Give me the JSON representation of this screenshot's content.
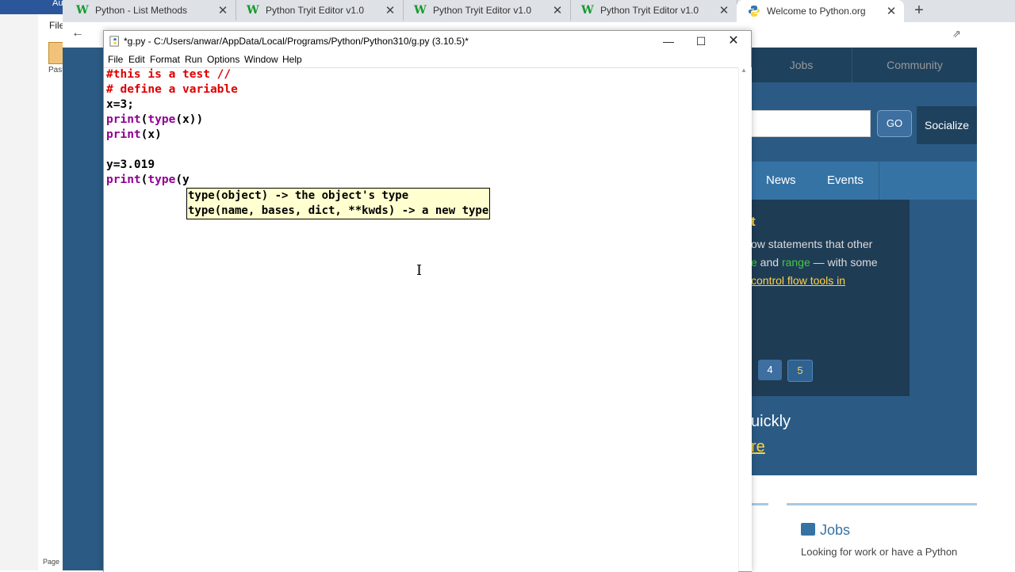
{
  "word": {
    "title_fragment": "Au",
    "menu_file": "File",
    "paste_label": "Past",
    "status": "Page"
  },
  "browser": {
    "tabs": [
      {
        "label": "Python - List Methods",
        "icon": "w3schools-icon",
        "active": false
      },
      {
        "label": "Python Tryit Editor v1.0",
        "icon": "w3schools-icon",
        "active": false
      },
      {
        "label": "Python Tryit Editor v1.0",
        "icon": "w3schools-icon",
        "active": false
      },
      {
        "label": "Python Tryit Editor v1.0",
        "icon": "w3schools-icon",
        "active": false
      },
      {
        "label": "Welcome to Python.org",
        "icon": "python-icon",
        "active": true
      }
    ],
    "new_tab": "+",
    "tab_close": "✕",
    "w3_glyph": "W"
  },
  "pythonorg": {
    "nav": [
      "Jobs",
      "Community"
    ],
    "go_label": "GO",
    "socialize": "Socialize",
    "menu": [
      "News",
      "Events"
    ],
    "heading_fragment": "t",
    "text_line1": "ow statements that other",
    "text_line2_green1": "e",
    "text_line2_mid": " and ",
    "text_line2_green2": "range",
    "text_line2_end": " — with some",
    "text_line3_link": "control flow tools in",
    "pages": [
      "4",
      "5"
    ],
    "quickly": "uickly",
    "re_link": "re",
    "jobs_title": "Jobs",
    "jobs_text": "Looking for work or have a Python"
  },
  "idle": {
    "title": "*g.py - C:/Users/anwar/AppData/Local/Programs/Python/Python310/g.py (3.10.5)*",
    "menu": [
      "File",
      "Edit",
      "Format",
      "Run",
      "Options",
      "Window",
      "Help"
    ],
    "code": {
      "line1": "#this is a test //",
      "line2": "# define a variable",
      "line3": "x=3;",
      "line4_kw1": "print",
      "line4_a": "(",
      "line4_kw2": "type",
      "line4_b": "(x))",
      "line5_kw": "print",
      "line5_b": "(x)",
      "line7": "y=3.019",
      "line8_kw1": "print",
      "line8_a": "(",
      "line8_kw2": "type",
      "line8_b": "(y"
    },
    "calltip": [
      "type(object) -> the object's type",
      "type(name, bases, dict, **kwds) -> a new type"
    ]
  }
}
